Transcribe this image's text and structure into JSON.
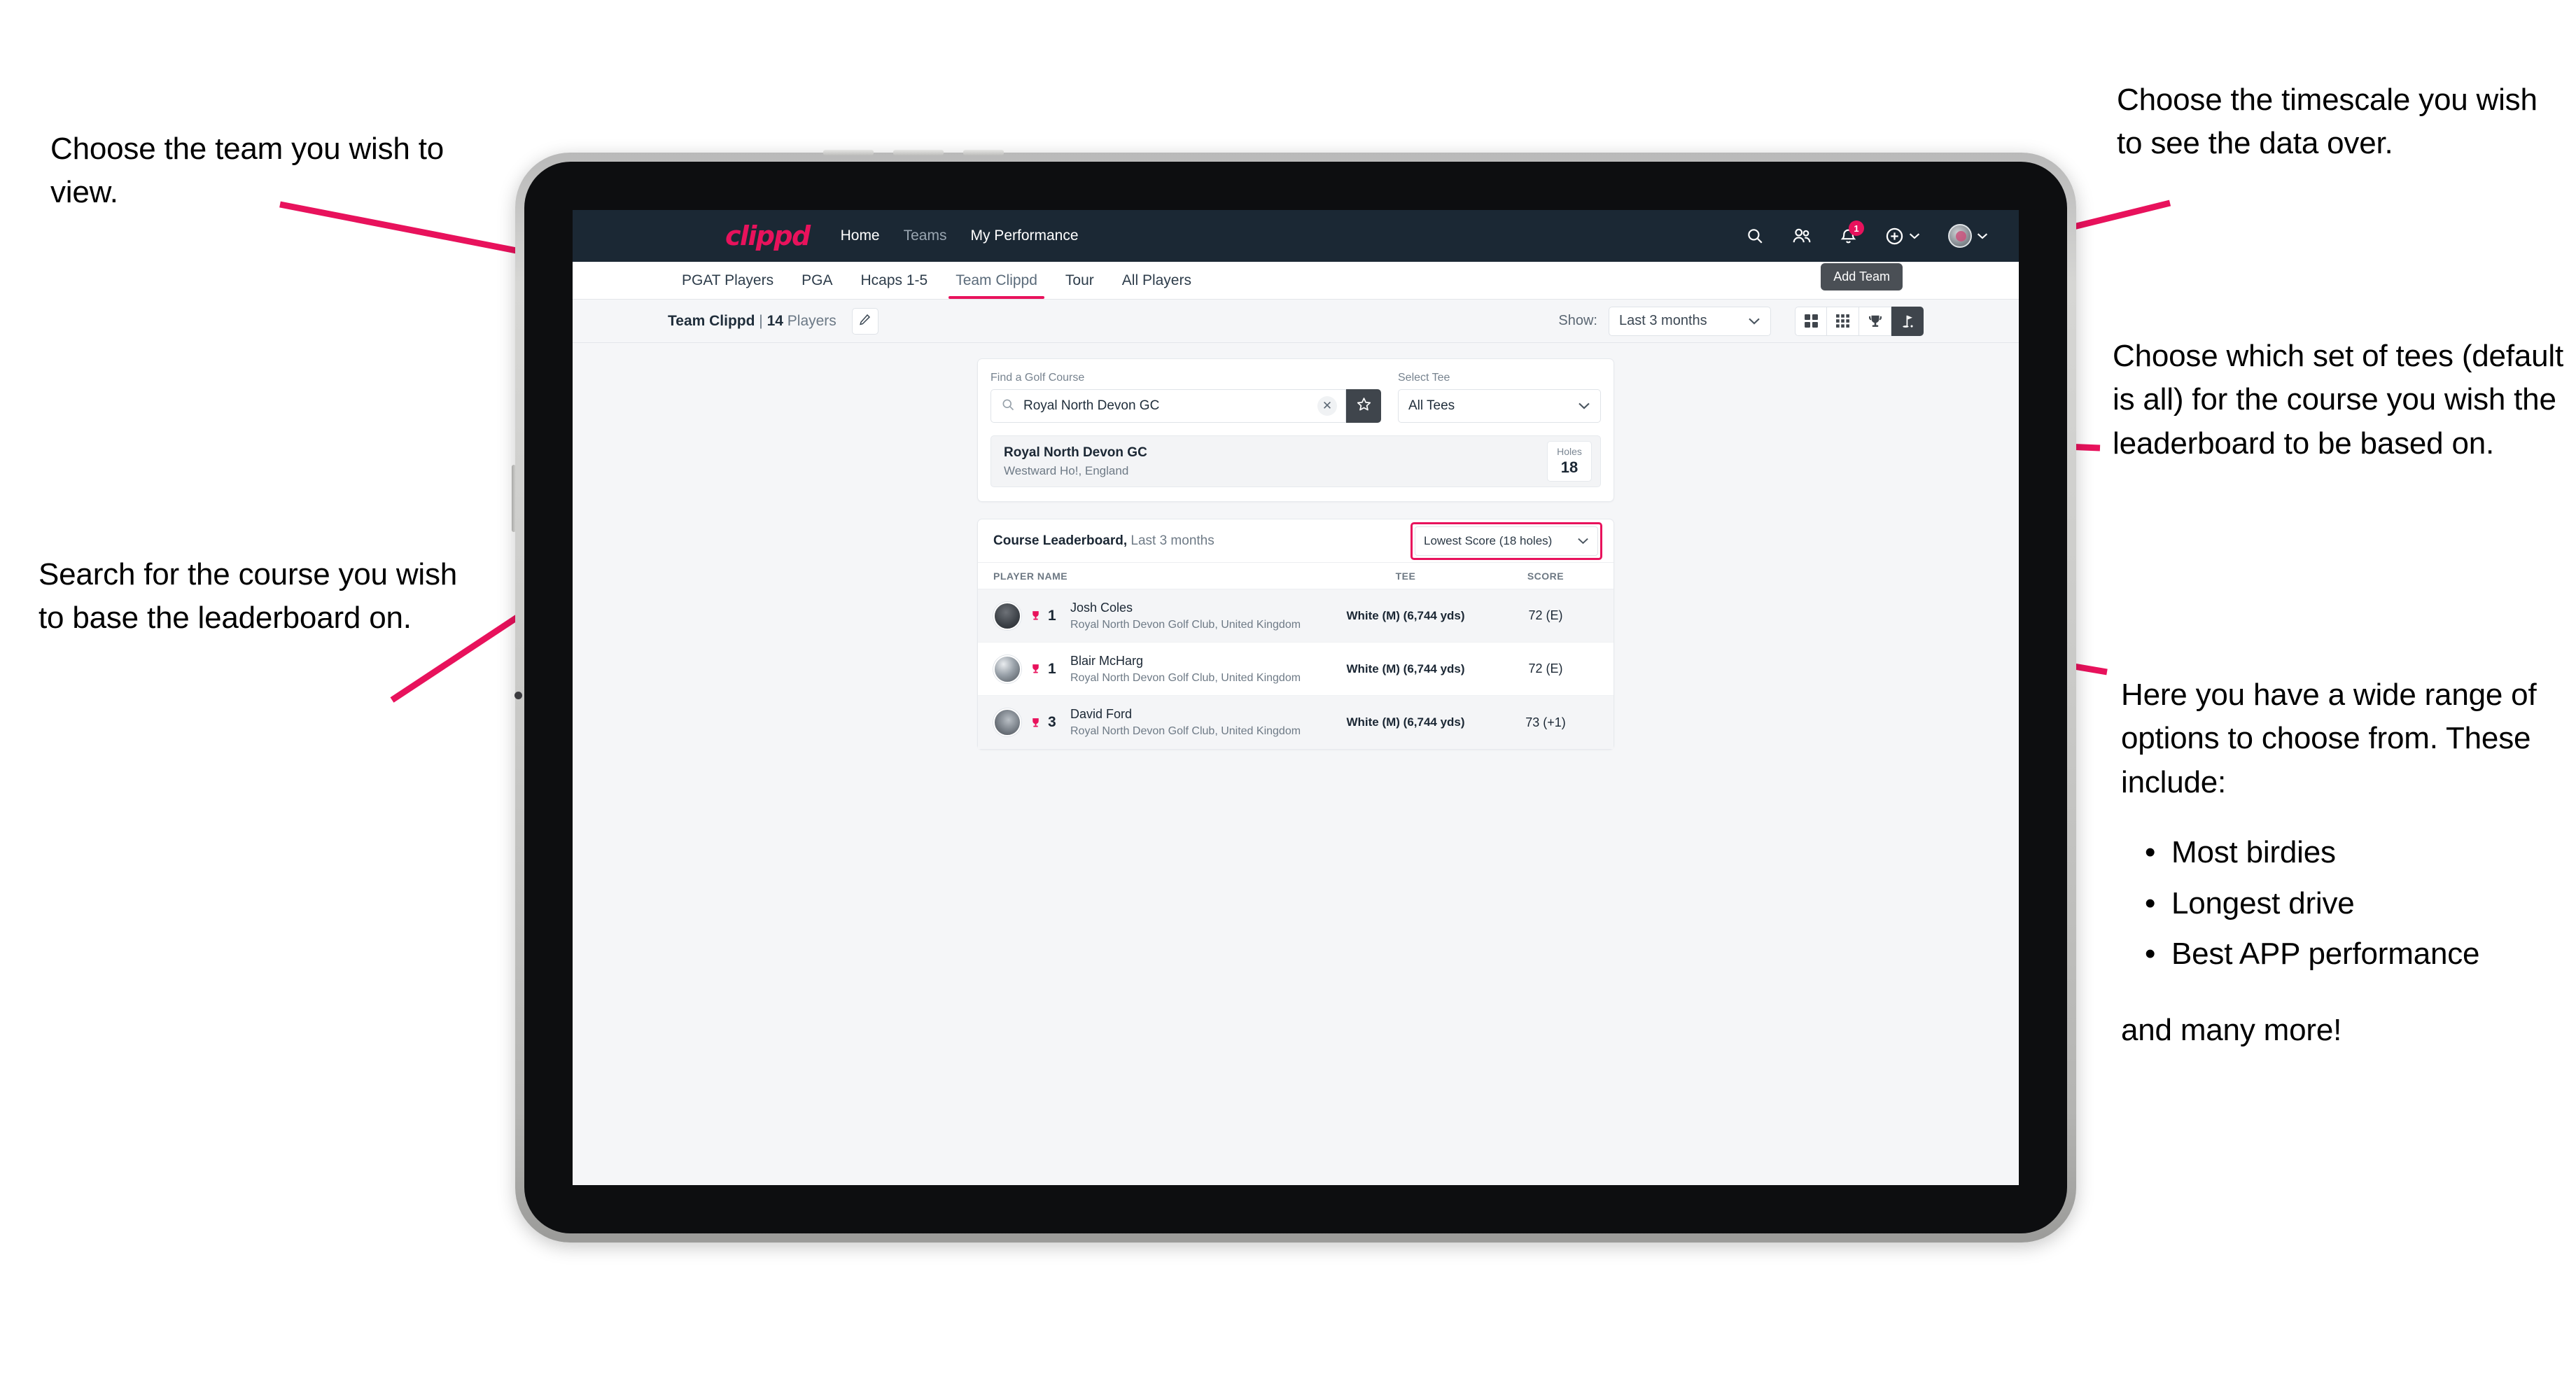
{
  "annotations": {
    "team": "Choose the team you wish to view.",
    "search": "Search for the course you wish to base the leaderboard on.",
    "timescale": "Choose the timescale you wish to see the data over.",
    "tees": "Choose which set of tees (default is all) for the course you wish the leaderboard to be based on.",
    "options_intro": "Here you have a wide range of options to choose from. These include:",
    "options_list": [
      "Most birdies",
      "Longest drive",
      "Best APP performance"
    ],
    "options_tail": "and many more!"
  },
  "navbar": {
    "brand": "clippd",
    "links": [
      {
        "label": "Home",
        "active": true
      },
      {
        "label": "Teams",
        "active": false
      },
      {
        "label": "My Performance",
        "active": true
      }
    ],
    "icons": {
      "search": "search-icon",
      "people": "people-icon",
      "notifications": "bell-icon",
      "add": "plus-circle-icon",
      "profile": "avatar-icon"
    },
    "notification_count": "1"
  },
  "tabs": [
    {
      "label": "PGAT Players",
      "active": false
    },
    {
      "label": "PGA",
      "active": false
    },
    {
      "label": "Hcaps 1-5",
      "active": false
    },
    {
      "label": "Team Clippd",
      "active": true
    },
    {
      "label": "Tour",
      "active": false
    },
    {
      "label": "All Players",
      "active": false
    }
  ],
  "tooltip": {
    "add_team": "Add Team"
  },
  "toolbar": {
    "team_name": "Team Clippd",
    "separator": " | ",
    "player_count": "14",
    "players_word": " Players",
    "edit_icon": "pencil-icon",
    "show_label": "Show:",
    "period_value": "Last 3 months",
    "view_buttons": [
      {
        "name": "grid-large-view",
        "active": false
      },
      {
        "name": "grid-small-view",
        "active": false
      },
      {
        "name": "trophy-view",
        "active": false
      },
      {
        "name": "course-view",
        "active": true
      }
    ]
  },
  "search_panel": {
    "course_label": "Find a Golf Course",
    "course_value": "Royal North Devon GC",
    "course_placeholder": "Find a Golf Course",
    "clear_icon": "close-icon",
    "star_icon": "star-icon",
    "tee_label": "Select Tee",
    "tee_value": "All Tees"
  },
  "course_result": {
    "name": "Royal North Devon GC",
    "location": "Westward Ho!, England",
    "holes_label": "Holes",
    "holes_value": "18"
  },
  "leaderboard": {
    "title": "Course Leaderboard,",
    "subtitle": " Last 3 months",
    "metric_value": "Lowest Score (18 holes)",
    "columns": [
      "PLAYER NAME",
      "TEE",
      "SCORE"
    ],
    "rows": [
      {
        "rank": "1",
        "name": "Josh Coles",
        "club": "Royal North Devon Golf Club, United Kingdom",
        "tee": "White (M) (6,744 yds)",
        "score": "72 (E)"
      },
      {
        "rank": "1",
        "name": "Blair McHarg",
        "club": "Royal North Devon Golf Club, United Kingdom",
        "tee": "White (M) (6,744 yds)",
        "score": "72 (E)"
      },
      {
        "rank": "3",
        "name": "David Ford",
        "club": "Royal North Devon Golf Club, United Kingdom",
        "tee": "White (M) (6,744 yds)",
        "score": "73 (+1)"
      }
    ]
  },
  "colors": {
    "accent_pink": "#e8125c",
    "navbar_dark": "#1b2834",
    "page_bg": "#f5f6f8",
    "dark_button": "#3f454c"
  }
}
